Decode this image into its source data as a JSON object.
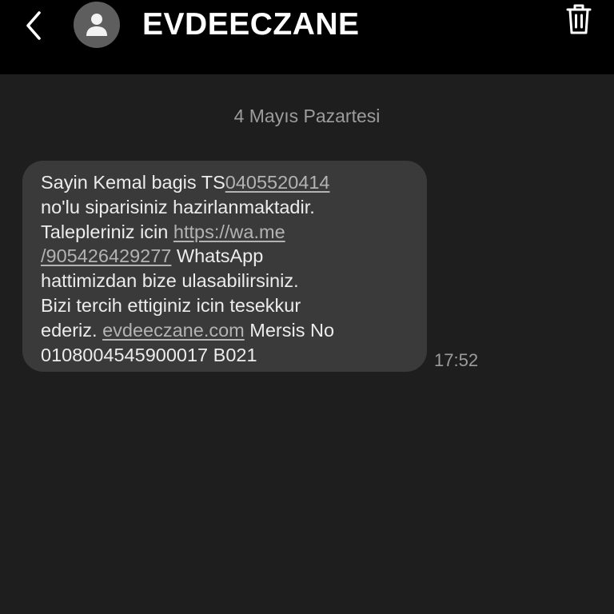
{
  "header": {
    "contact_name": "EVDEECZANE",
    "icons": {
      "back": "chevron-left-icon",
      "avatar": "person-icon",
      "delete": "trash-icon"
    }
  },
  "conversation": {
    "date_separator": "4 Mayıs Pazartesi",
    "messages": [
      {
        "time": "17:52",
        "line1_text": "Sayin Kemal bagis TS",
        "line1_link": "0405520414",
        "line2_text": "no'lu siparisiniz hazirlanmaktadir.",
        "line3_text": "Talepleriniz icin ",
        "line3_link": "https://wa.me",
        "line4_link": "/905426429277",
        "line4_text": " WhatsApp",
        "line5_text": "hattimizdan bize ulasabilirsiniz.",
        "line6_text": "Bizi tercih ettiginiz icin tesekkur",
        "line7_text": "ederiz. ",
        "line7_link": "evdeeczane.com",
        "line7_text_after": " Mersis No",
        "line8_text": "0108004545900017 B021"
      }
    ]
  },
  "colors": {
    "background": "#1e1e1e",
    "topbar": "#000000",
    "bubble": "#3a3a3a",
    "text": "#ececec",
    "muted": "#9c9c9c",
    "link": "#b3b3b3"
  }
}
